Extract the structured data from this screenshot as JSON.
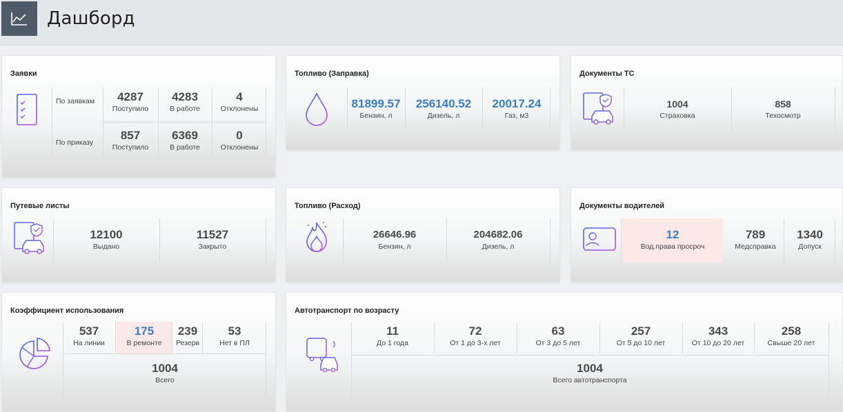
{
  "header": {
    "title": "Дашборд"
  },
  "requests": {
    "title": "Заявки",
    "rows": [
      {
        "label": "По заявкам",
        "stats": [
          {
            "value": "4287",
            "label": "Поступило"
          },
          {
            "value": "4283",
            "label": "В работе"
          },
          {
            "value": "4",
            "label": "Отклонены"
          }
        ]
      },
      {
        "label": "По приказу",
        "stats": [
          {
            "value": "857",
            "label": "Поступило"
          },
          {
            "value": "6369",
            "label": "В работе"
          },
          {
            "value": "0",
            "label": "Отклонены"
          }
        ]
      }
    ]
  },
  "fuel_refill": {
    "title": "Топливо (Заправка)",
    "stats": [
      {
        "value": "81899.57",
        "label": "Бензин, л"
      },
      {
        "value": "256140.52",
        "label": "Дизель, л"
      },
      {
        "value": "20017.24",
        "label": "Газ, м3"
      }
    ]
  },
  "vehicle_docs": {
    "title": "Документы ТС",
    "stats": [
      {
        "value": "1004",
        "label": "Страховка"
      },
      {
        "value": "858",
        "label": "Техосмотр"
      }
    ]
  },
  "waybills": {
    "title": "Путевые листы",
    "stats": [
      {
        "value": "12100",
        "label": "Выдано"
      },
      {
        "value": "11527",
        "label": "Закрыто"
      }
    ]
  },
  "fuel_usage": {
    "title": "Топливо (Расход)",
    "stats": [
      {
        "value": "26646.96",
        "label": "Бензин, л"
      },
      {
        "value": "204682.06",
        "label": "Дизель, л"
      }
    ]
  },
  "driver_docs": {
    "title": "Документы водителей",
    "stats": [
      {
        "value": "12",
        "label": "Вод.права просроч"
      },
      {
        "value": "789",
        "label": "Медсправка"
      },
      {
        "value": "1340",
        "label": "Допуск"
      }
    ]
  },
  "utilization": {
    "title": "Коэффициент использования",
    "stats": [
      {
        "value": "537",
        "label": "На линии"
      },
      {
        "value": "175",
        "label": "В ремонте"
      },
      {
        "value": "239",
        "label": "Резерв"
      },
      {
        "value": "53",
        "label": "Нет в ПЛ"
      }
    ],
    "total": {
      "value": "1004",
      "label": "Всего"
    }
  },
  "vehicle_age": {
    "title": "Автотранспорт по возрасту",
    "stats": [
      {
        "value": "11",
        "label": "До 1 года"
      },
      {
        "value": "72",
        "label": "От 1 до 3-х лет"
      },
      {
        "value": "63",
        "label": "От 3 до 5 лет"
      },
      {
        "value": "257",
        "label": "От 5 до 10 лет"
      },
      {
        "value": "343",
        "label": "От 10 до 20 лет"
      },
      {
        "value": "258",
        "label": "Свыше 20 лет"
      }
    ],
    "total": {
      "value": "1004",
      "label": "Всего автотранспорта"
    }
  },
  "icons": {
    "header": "line-chart-icon",
    "requests": "checklist-document-icon",
    "fuel_refill": "drop-icon",
    "vehicle_docs": "document-car-icon",
    "waybills": "document-car-icon",
    "fuel_usage": "fire-icon",
    "driver_docs": "id-card-icon",
    "utilization": "pie-chart-icon",
    "vehicle_age": "bus-car-icon"
  },
  "colors": {
    "accent_blue": "#3a7cc4",
    "highlight_red": "#fde8e8",
    "icon_gradient_start": "#3a6de0",
    "icon_gradient_end": "#c14be0"
  }
}
